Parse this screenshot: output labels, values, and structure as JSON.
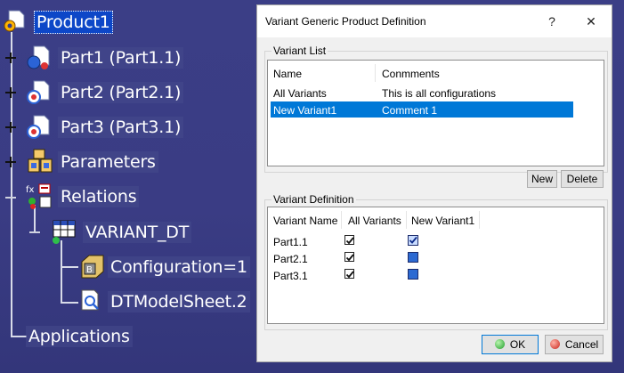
{
  "tree": {
    "root": "Product1",
    "items": [
      {
        "label": "Part1 (Part1.1)",
        "icon": "part-icon"
      },
      {
        "label": "Part2 (Part2.1)",
        "icon": "part-icon"
      },
      {
        "label": "Part3 (Part3.1)",
        "icon": "part-icon"
      },
      {
        "label": "Parameters",
        "icon": "parameters-icon"
      },
      {
        "label": "Relations",
        "icon": "relations-icon"
      }
    ],
    "variant_dt": "VARIANT_DT",
    "configuration": "Configuration=1",
    "dtmodelsheet": "DTModelSheet.2",
    "applications": "Applications"
  },
  "dialog": {
    "title": "Variant Generic Product Definition",
    "help": "?",
    "close": "✕",
    "variant_list": {
      "label": "Variant List",
      "headers": {
        "name": "Name",
        "comments": "Conmments"
      },
      "rows": [
        {
          "name": "All Variants",
          "comment": "This is all configurations"
        },
        {
          "name": "New Variant1",
          "comment": "Comment 1"
        }
      ]
    },
    "new_button": "New",
    "delete_button": "Delete",
    "variant_definition": {
      "label": "Variant Definition",
      "headers": {
        "name": "Variant Name",
        "all": "All Variants",
        "nv1": "New Variant1"
      },
      "rows": [
        {
          "name": "Part1.1",
          "all": true,
          "nv1": true
        },
        {
          "name": "Part2.1",
          "all": true,
          "nv1": false
        },
        {
          "name": "Part3.1",
          "all": true,
          "nv1": false
        }
      ]
    },
    "ok_button": "OK",
    "cancel_button": "Cancel"
  },
  "colors": {
    "selection": "#0078d7",
    "tree_selection": "#0d47c8",
    "background": "#3b3e86"
  }
}
